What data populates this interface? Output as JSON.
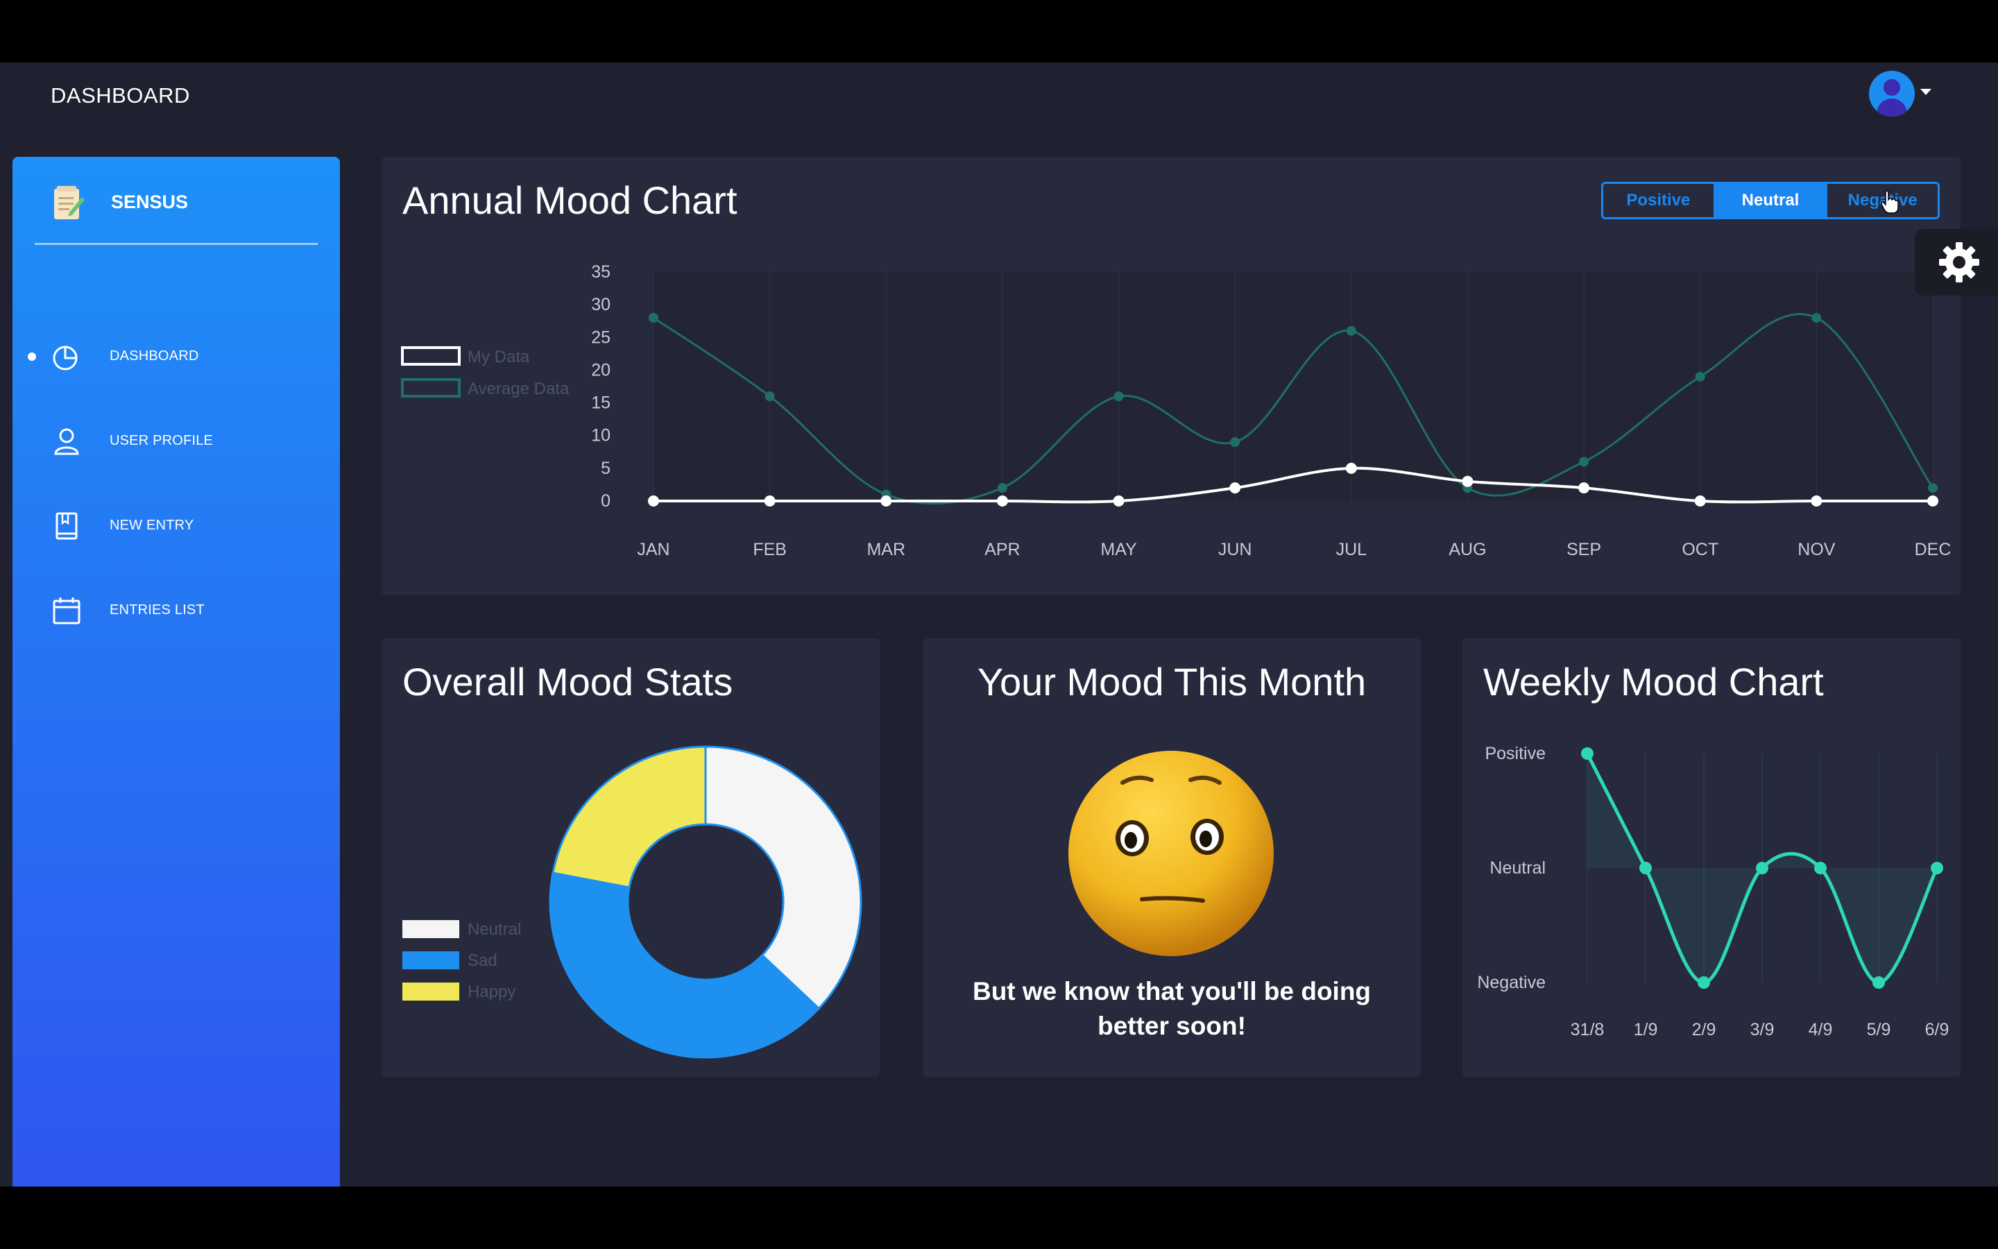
{
  "header": {
    "title": "DASHBOARD"
  },
  "sidebar": {
    "brand": "SENSUS",
    "items": [
      {
        "label": "DASHBOARD",
        "icon": "pie-chart-icon",
        "active": true
      },
      {
        "label": "USER PROFILE",
        "icon": "user-icon",
        "active": false
      },
      {
        "label": "NEW ENTRY",
        "icon": "book-icon",
        "active": false
      },
      {
        "label": "ENTRIES LIST",
        "icon": "calendar-icon",
        "active": false
      }
    ]
  },
  "annual": {
    "title": "Annual Mood Chart",
    "toggles": [
      {
        "label": "Positive",
        "active": false
      },
      {
        "label": "Neutral",
        "active": true
      },
      {
        "label": "Negative",
        "active": false
      }
    ]
  },
  "stats": {
    "title": "Overall Mood Stats"
  },
  "month": {
    "title": "Your Mood This Month",
    "message": "But we know that you'll be doing better soon!"
  },
  "weekly": {
    "title": "Weekly Mood Chart"
  },
  "colors": {
    "accent": "#1a86f0",
    "average_line": "#1f6f66",
    "my_line": "#ffffff",
    "weekly_line": "#2ed8b3",
    "neutral": "#f5f5f5",
    "sad": "#1e90f0",
    "happy": "#f1e858"
  },
  "chart_data": [
    {
      "type": "line",
      "title": "Annual Mood Chart",
      "categories": [
        "JAN",
        "FEB",
        "MAR",
        "APR",
        "MAY",
        "JUN",
        "JUL",
        "AUG",
        "SEP",
        "OCT",
        "NOV",
        "DEC"
      ],
      "series": [
        {
          "name": "My Data",
          "values": [
            0,
            0,
            0,
            0,
            0,
            2,
            5,
            3,
            2,
            0,
            0,
            0
          ]
        },
        {
          "name": "Average Data",
          "values": [
            28,
            16,
            1,
            2,
            16,
            9,
            26,
            2,
            6,
            19,
            28,
            2
          ]
        }
      ],
      "ylim": [
        0,
        35
      ],
      "yticks": [
        0,
        5,
        10,
        15,
        20,
        25,
        30,
        35
      ],
      "legend": "left"
    },
    {
      "type": "pie",
      "title": "Overall Mood Stats",
      "labels": [
        "Neutral",
        "Sad",
        "Happy"
      ],
      "values": [
        37,
        41,
        22
      ],
      "legend": "left"
    },
    {
      "type": "line",
      "title": "Weekly Mood Chart",
      "categories": [
        "31/8",
        "1/9",
        "2/9",
        "3/9",
        "4/9",
        "5/9",
        "6/9"
      ],
      "values": [
        2,
        1,
        0,
        1,
        1,
        0,
        1
      ],
      "ytick_labels": [
        "Negative",
        "Neutral",
        "Positive"
      ],
      "ylim": [
        0,
        2
      ]
    }
  ]
}
